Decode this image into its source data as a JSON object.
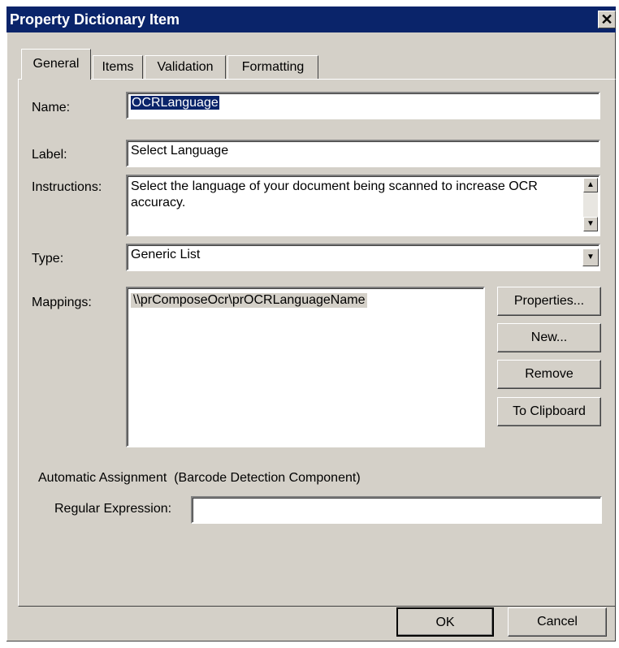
{
  "window": {
    "title": "Property Dictionary Item",
    "close_glyph": "✕"
  },
  "tabs": [
    {
      "label": "General",
      "active": true
    },
    {
      "label": "Items",
      "active": false
    },
    {
      "label": "Validation",
      "active": false
    },
    {
      "label": "Formatting",
      "active": false
    }
  ],
  "form": {
    "name_label": "Name:",
    "name_value": "OCRLanguage",
    "label_label": "Label:",
    "label_value": "Select Language",
    "instructions_label": "Instructions:",
    "instructions_value": "Select the language of your document being scanned to increase OCR accuracy.",
    "type_label": "Type:",
    "type_value": "Generic List",
    "mappings_label": "Mappings:",
    "mappings_items": [
      "\\\\prComposeOcr\\prOCRLanguageName"
    ]
  },
  "mapping_buttons": {
    "properties": "Properties...",
    "new": "New...",
    "remove": "Remove",
    "clipboard": "To Clipboard"
  },
  "auto_assignment": {
    "heading": "Automatic Assignment  (Barcode Detection Component)",
    "regex_label": "Regular Expression:",
    "regex_value": ""
  },
  "footer": {
    "ok": "OK",
    "cancel": "Cancel"
  },
  "colors": {
    "face": "#d4d0c8",
    "title_bar": "#0a246a",
    "selection": "#0a246a"
  }
}
